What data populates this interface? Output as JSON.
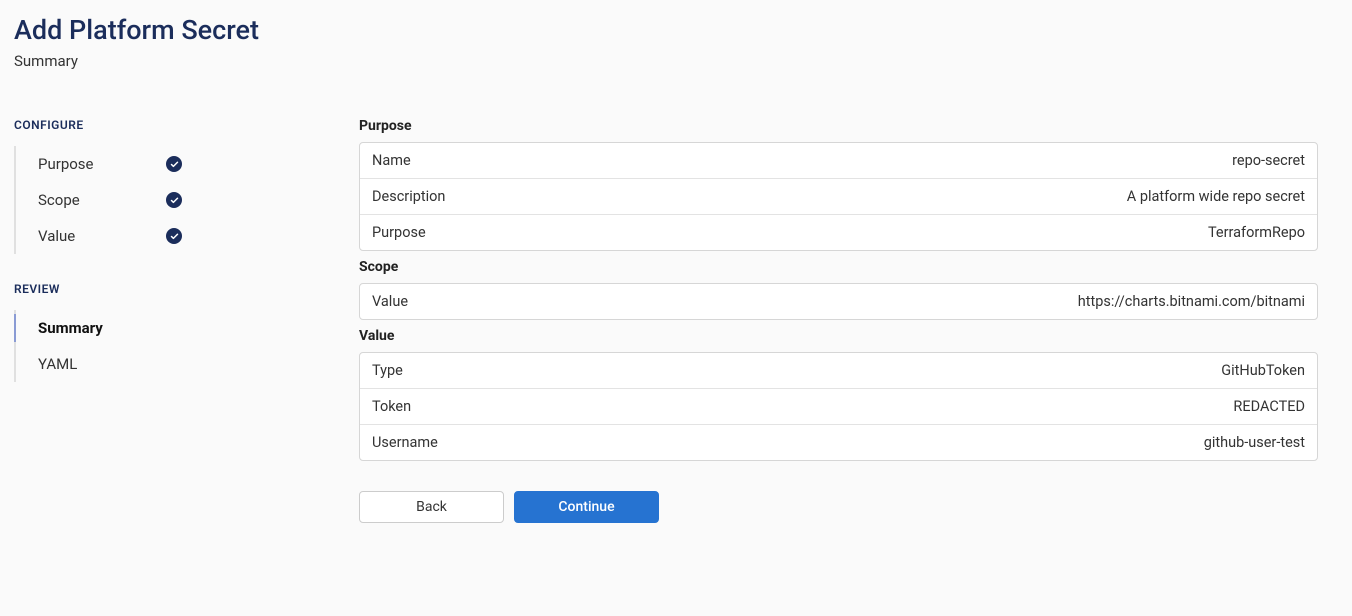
{
  "header": {
    "title": "Add Platform Secret",
    "subtitle": "Summary"
  },
  "sidebar": {
    "configure": {
      "header": "CONFIGURE",
      "items": [
        {
          "label": "Purpose",
          "done": true
        },
        {
          "label": "Scope",
          "done": true
        },
        {
          "label": "Value",
          "done": true
        }
      ]
    },
    "review": {
      "header": "REVIEW",
      "items": [
        {
          "label": "Summary",
          "active": true
        },
        {
          "label": "YAML",
          "active": false
        }
      ]
    }
  },
  "summary": {
    "purpose": {
      "title": "Purpose",
      "rows": [
        {
          "label": "Name",
          "value": "repo-secret"
        },
        {
          "label": "Description",
          "value": "A platform wide repo secret"
        },
        {
          "label": "Purpose",
          "value": "TerraformRepo"
        }
      ]
    },
    "scope": {
      "title": "Scope",
      "rows": [
        {
          "label": "Value",
          "value": "https://charts.bitnami.com/bitnami"
        }
      ]
    },
    "value": {
      "title": "Value",
      "rows": [
        {
          "label": "Type",
          "value": "GitHubToken"
        },
        {
          "label": "Token",
          "value": "REDACTED"
        },
        {
          "label": "Username",
          "value": "github-user-test"
        }
      ]
    }
  },
  "buttons": {
    "back": "Back",
    "continue": "Continue"
  }
}
